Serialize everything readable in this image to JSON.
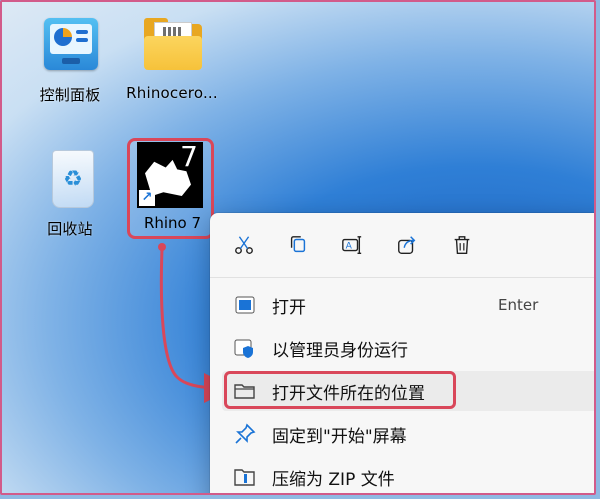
{
  "desktop": {
    "icons": [
      {
        "label": "控制面板",
        "icon": "control-panel-icon"
      },
      {
        "label": "Rhinocero...",
        "icon": "folder-icon"
      },
      {
        "label": "回收站",
        "icon": "recycle-bin-icon"
      },
      {
        "label": "Rhino 7",
        "icon": "rhino-app-shortcut-icon"
      }
    ],
    "rhino_tile_number": "7"
  },
  "context_menu": {
    "toolbar": [
      {
        "name": "cut",
        "icon": "scissors-icon"
      },
      {
        "name": "copy",
        "icon": "copy-icon"
      },
      {
        "name": "rename",
        "icon": "rename-icon"
      },
      {
        "name": "share",
        "icon": "share-icon"
      },
      {
        "name": "delete",
        "icon": "trash-icon"
      }
    ],
    "items": [
      {
        "label": "打开",
        "shortcut": "Enter",
        "icon": "open-app-icon"
      },
      {
        "label": "以管理员身份运行",
        "icon": "shield-icon"
      },
      {
        "label": "打开文件所在的位置",
        "icon": "folder-outline-icon"
      },
      {
        "label": "固定到\"开始\"屏幕",
        "icon": "pin-icon"
      },
      {
        "label": "压缩为 ZIP 文件",
        "icon": "zip-folder-icon"
      }
    ]
  },
  "colors": {
    "highlight": "#d9475a",
    "accent": "#1a73d6"
  }
}
